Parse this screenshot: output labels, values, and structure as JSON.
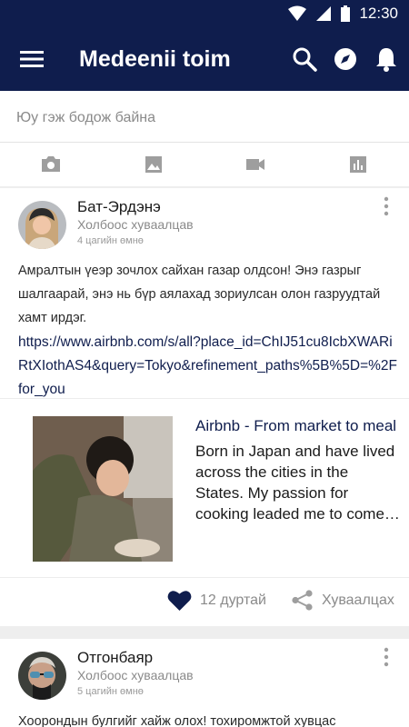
{
  "status": {
    "time": "12:30",
    "icons": [
      "wifi-icon",
      "signal-icon",
      "battery-icon"
    ]
  },
  "appbar": {
    "title": "Medeenii toim",
    "icons": [
      "menu-icon",
      "search-icon",
      "compass-icon",
      "bell-icon"
    ],
    "color": "#0f1d4d"
  },
  "composer": {
    "placeholder": "Юу гэж бодож байна"
  },
  "attachments": [
    "camera-icon",
    "image-icon",
    "video-icon",
    "poll-icon"
  ],
  "posts": [
    {
      "author": "Бат-Эрдэнэ",
      "source": "Холбоос хуваалцав",
      "time": "4 цагийн өмнө",
      "text": "Амралтын үеэр зочлох сайхан газар олдсон! Энэ газрыг шалгаарай, энэ нь бүр аялахад зориулсан олон газруудтай хамт ирдэг.",
      "link": "https://www.airbnb.com/s/all?place_id=ChIJ51cu8IcbXWARiRtXIothAS4&query=Tokyo&refinement_paths%5B%5D=%2Ffor_you",
      "preview": {
        "title": "Airbnb - From market to meal",
        "description": "Born in Japan and have lived across the cities in the States. My passion for cooking leaded me to come…"
      },
      "likes": "12 дуртай",
      "share": "Хуваалцах"
    },
    {
      "author": "Отгонбаяр",
      "source": "Холбоос хуваалцав",
      "time": "5 цагийн өмнө",
      "text": "Хоорондын булгийг хайж олох! тохиромжтой хувцас"
    }
  ]
}
